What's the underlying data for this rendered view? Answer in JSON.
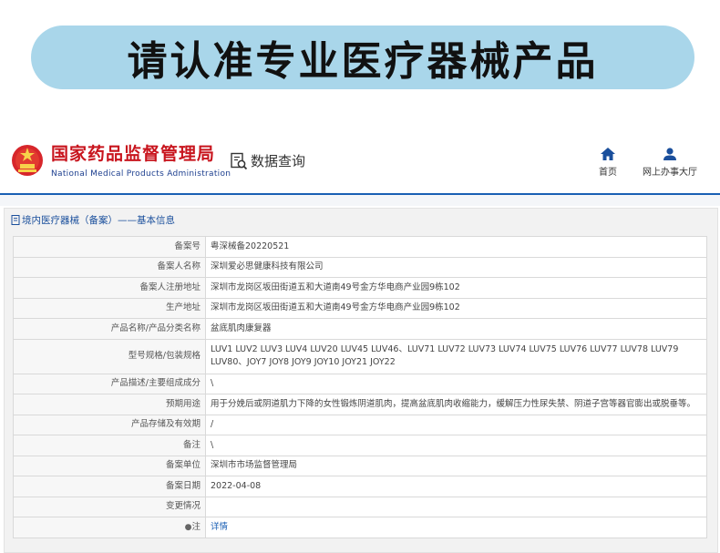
{
  "banner": {
    "title": "请认准专业医疗器械产品"
  },
  "header": {
    "agency_cn": "国家药品监督管理局",
    "agency_en": "National Medical Products Administration",
    "query_label": "数据查询",
    "nav": [
      {
        "label": "首页",
        "icon": "home-icon"
      },
      {
        "label": "网上办事大厅",
        "icon": "user-icon"
      }
    ]
  },
  "breadcrumb": {
    "text": "境内医疗器械（备案）——基本信息"
  },
  "record": {
    "rows": [
      {
        "label": "备案号",
        "value": "粤深械备20220521"
      },
      {
        "label": "备案人名称",
        "value": "深圳爱必思健康科技有限公司"
      },
      {
        "label": "备案人注册地址",
        "value": "深圳市龙岗区坂田街道五和大道南49号金方华电商产业园9栋102"
      },
      {
        "label": "生产地址",
        "value": "深圳市龙岗区坂田街道五和大道南49号金方华电商产业园9栋102"
      },
      {
        "label": "产品名称/产品分类名称",
        "value": "盆底肌肉康复器"
      },
      {
        "label": "型号规格/包装规格",
        "value": "LUV1 LUV2 LUV3 LUV4 LUV20 LUV45 LUV46、LUV71 LUV72 LUV73 LUV74 LUV75 LUV76 LUV77 LUV78 LUV79 LUV80、JOY7 JOY8 JOY9 JOY10 JOY21 JOY22"
      },
      {
        "label": "产品描述/主要组成成分",
        "value": "\\"
      },
      {
        "label": "预期用途",
        "value": "用于分娩后或阴道肌力下降的女性锻炼阴道肌肉，提高盆底肌肉收缩能力，缓解压力性尿失禁、阴道子宫等器官膨出或脱垂等。"
      },
      {
        "label": "产品存储及有效期",
        "value": "/"
      },
      {
        "label": "备注",
        "value": "\\"
      },
      {
        "label": "备案单位",
        "value": "深圳市市场监督管理局"
      },
      {
        "label": "备案日期",
        "value": "2022-04-08"
      },
      {
        "label": "变更情况",
        "value": ""
      },
      {
        "label": "注",
        "value": "详情"
      }
    ]
  },
  "colors": {
    "banner_bg": "#a9d6ea",
    "agency_red": "#c8141d",
    "nav_blue": "#1a5fb4"
  }
}
